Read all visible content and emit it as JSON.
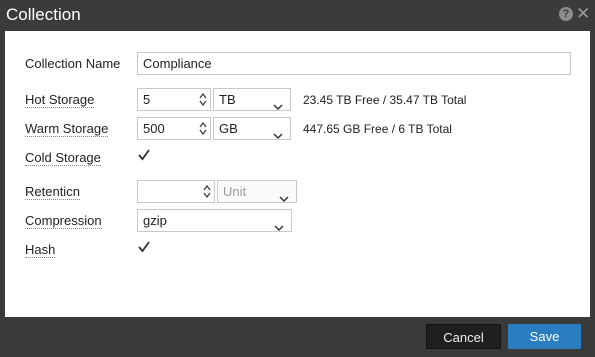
{
  "dialog": {
    "title": "Collection",
    "help_icon": "help-icon",
    "close_icon": "close-icon"
  },
  "form": {
    "collection_name": {
      "label": "Collection Name",
      "value": "Compliance"
    },
    "hot_storage": {
      "label": "Hot Storage",
      "value": "5",
      "unit": "TB",
      "info": "23.45 TB Free / 35.47 TB Total"
    },
    "warm_storage": {
      "label": "Warm Storage",
      "value": "500",
      "unit": "GB",
      "info": "447.65 GB Free / 6 TB Total"
    },
    "cold_storage": {
      "label": "Cold Storage",
      "checked": true
    },
    "retention": {
      "label": "Retenticn",
      "value": "",
      "unit_placeholder": "Unit"
    },
    "compression": {
      "label": "Compression",
      "value": "gzip"
    },
    "hash": {
      "label": "Hash",
      "checked": true
    }
  },
  "footer": {
    "cancel_label": "Cancel",
    "save_label": "Save"
  },
  "colors": {
    "titlebar": "#3b3b3b",
    "save_button": "#2a7dc0",
    "cancel_button": "#1f1f1f"
  }
}
